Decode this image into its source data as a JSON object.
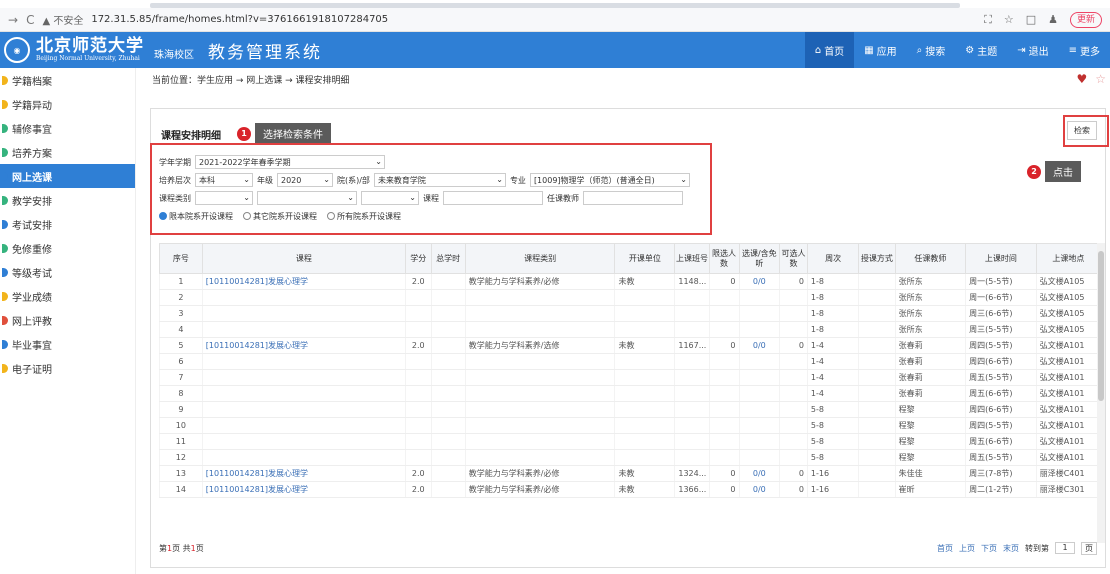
{
  "browser": {
    "warning": "▲ 不安全",
    "url": "172.31.5.85/frame/homes.html?v=3761661918107284705",
    "update": "更新"
  },
  "header": {
    "school_cn": "北京师范大学",
    "school_en": "Beijing Normal University, Zhuhai",
    "campus": "珠海校区",
    "system_title": "教务管理系统",
    "nav": [
      {
        "label": "首页",
        "icon": "home-icon"
      },
      {
        "label": "应用",
        "icon": "apps-icon"
      },
      {
        "label": "搜索",
        "icon": "search-icon"
      },
      {
        "label": "主题",
        "icon": "theme-icon"
      },
      {
        "label": "退出",
        "icon": "logout-icon"
      },
      {
        "label": "更多",
        "icon": "more-icon"
      }
    ]
  },
  "sidebar": {
    "items": [
      {
        "label": "学籍档案",
        "color": "#f2b41c"
      },
      {
        "label": "学籍异动",
        "color": "#f2b41c"
      },
      {
        "label": "辅修事宜",
        "color": "#36b37e"
      },
      {
        "label": "培养方案",
        "color": "#36b37e"
      },
      {
        "label": "网上选课",
        "color": "#ffffff",
        "active": true
      },
      {
        "label": "教学安排",
        "color": "#36b37e"
      },
      {
        "label": "考试安排",
        "color": "#2f7fd5"
      },
      {
        "label": "免修重修",
        "color": "#36b37e"
      },
      {
        "label": "等级考试",
        "color": "#2f7fd5"
      },
      {
        "label": "学业成绩",
        "color": "#f2b41c"
      },
      {
        "label": "网上评教",
        "color": "#e0503c"
      },
      {
        "label": "毕业事宜",
        "color": "#2f7fd5"
      },
      {
        "label": "电子证明",
        "color": "#f2b41c"
      }
    ]
  },
  "breadcrumb": {
    "prefix": "当前位置：",
    "path": "学生应用 → 网上选课 → 课程安排明细"
  },
  "panel": {
    "title": "课程安排明细",
    "search_button": "检索",
    "callout1": {
      "num": "1",
      "text": "选择检索条件"
    },
    "callout2": {
      "num": "2",
      "text": "点击"
    }
  },
  "form": {
    "term_label": "学年学期",
    "term_value": "2021-2022学年春季学期",
    "level_label": "培养层次",
    "level_value": "本科",
    "grade_label": "年级",
    "grade_value": "2020",
    "dept_label": "院(系)/部",
    "dept_value": "未来教育学院",
    "major_label": "专业",
    "major_value": "[1009]物理学（师范）(普通全日)",
    "category_label": "课程类别",
    "course_label": "课程",
    "teacher_label": "任课教师",
    "radios": [
      {
        "label": "限本院系开设课程",
        "checked": true
      },
      {
        "label": "其它院系开设课程",
        "checked": false
      },
      {
        "label": "所有院系开设课程",
        "checked": false
      }
    ]
  },
  "table": {
    "headers": [
      "序号",
      "课程",
      "学分",
      "总学时",
      "课程类别",
      "开课单位",
      "上课班号",
      "限选人数",
      "选课/含免听",
      "可选人数",
      "周次",
      "授课方式",
      "任课教师",
      "上课时间",
      "上课地点"
    ],
    "rows": [
      [
        "1",
        "[10110014281]发展心理学",
        "2.0",
        "",
        "教学能力与学科素养/必修",
        "未教",
        "1148...",
        "0",
        "0/0",
        "0",
        "1-8",
        "",
        "张所东",
        "周一(5-5节)",
        "弘文楼A105"
      ],
      [
        "2",
        "",
        "",
        "",
        "",
        "",
        "",
        "",
        "",
        "",
        "1-8",
        "",
        "张所东",
        "周一(6-6节)",
        "弘文楼A105"
      ],
      [
        "3",
        "",
        "",
        "",
        "",
        "",
        "",
        "",
        "",
        "",
        "1-8",
        "",
        "张所东",
        "周三(6-6节)",
        "弘文楼A105"
      ],
      [
        "4",
        "",
        "",
        "",
        "",
        "",
        "",
        "",
        "",
        "",
        "1-8",
        "",
        "张所东",
        "周三(5-5节)",
        "弘文楼A105"
      ],
      [
        "5",
        "[10110014281]发展心理学",
        "2.0",
        "",
        "教学能力与学科素养/选修",
        "未教",
        "1167...",
        "0",
        "0/0",
        "0",
        "1-4",
        "",
        "张春莉",
        "周四(5-5节)",
        "弘文楼A101"
      ],
      [
        "6",
        "",
        "",
        "",
        "",
        "",
        "",
        "",
        "",
        "",
        "1-4",
        "",
        "张春莉",
        "周四(6-6节)",
        "弘文楼A101"
      ],
      [
        "7",
        "",
        "",
        "",
        "",
        "",
        "",
        "",
        "",
        "",
        "1-4",
        "",
        "张春莉",
        "周五(5-5节)",
        "弘文楼A101"
      ],
      [
        "8",
        "",
        "",
        "",
        "",
        "",
        "",
        "",
        "",
        "",
        "1-4",
        "",
        "张春莉",
        "周五(6-6节)",
        "弘文楼A101"
      ],
      [
        "9",
        "",
        "",
        "",
        "",
        "",
        "",
        "",
        "",
        "",
        "5-8",
        "",
        "程黎",
        "周四(6-6节)",
        "弘文楼A101"
      ],
      [
        "10",
        "",
        "",
        "",
        "",
        "",
        "",
        "",
        "",
        "",
        "5-8",
        "",
        "程黎",
        "周四(5-5节)",
        "弘文楼A101"
      ],
      [
        "11",
        "",
        "",
        "",
        "",
        "",
        "",
        "",
        "",
        "",
        "5-8",
        "",
        "程黎",
        "周五(6-6节)",
        "弘文楼A101"
      ],
      [
        "12",
        "",
        "",
        "",
        "",
        "",
        "",
        "",
        "",
        "",
        "5-8",
        "",
        "程黎",
        "周五(5-5节)",
        "弘文楼A101"
      ],
      [
        "13",
        "[10110014281]发展心理学",
        "2.0",
        "",
        "教学能力与学科素养/必修",
        "未教",
        "1324...",
        "0",
        "0/0",
        "0",
        "1-16",
        "",
        "朱佳佳",
        "周三(7-8节)",
        "丽泽楼C401"
      ],
      [
        "14",
        "[10110014281]发展心理学",
        "2.0",
        "",
        "教学能力与学科素养/必修",
        "未教",
        "1366...",
        "0",
        "0/0",
        "0",
        "1-16",
        "",
        "崔昕",
        "周二(1-2节)",
        "丽泽楼C301"
      ]
    ]
  },
  "pager": {
    "prefix": "第",
    "page": "1",
    "mid": "页 共",
    "total": "1",
    "suffix": "页",
    "links": [
      "首页",
      "上页",
      "下页",
      "末页"
    ],
    "goto_label": "转到第",
    "goto_value": "1",
    "goto_suffix": "页"
  },
  "colors": {
    "accent": "#2f7fd5",
    "callout": "#d9232a"
  }
}
